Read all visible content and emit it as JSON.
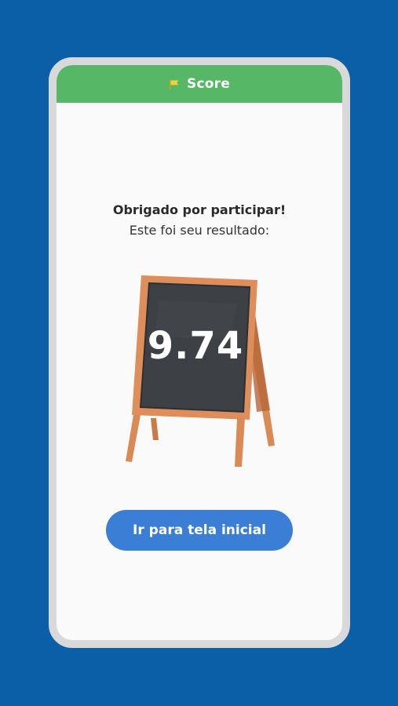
{
  "appbar": {
    "title": "Score",
    "icon": "flag-icon",
    "color": "#56B866"
  },
  "result": {
    "thanks": "Obrigado por participar!",
    "subtitle": "Este foi seu resultado:",
    "score": "9.74"
  },
  "actions": {
    "home_label": "Ir para tela inicial",
    "home_color": "#3A7FD5"
  },
  "background_color": "#0A5FA6"
}
